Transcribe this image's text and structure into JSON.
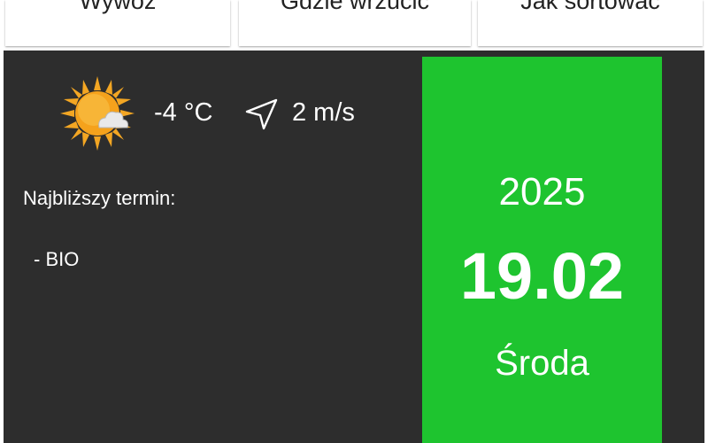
{
  "tabs": [
    {
      "label": "Wywóz"
    },
    {
      "label": "Gdzie wrzucić"
    },
    {
      "label": "Jak sortować"
    }
  ],
  "weather": {
    "temperature": "-4 °C",
    "wind": "2 m/s",
    "condition_icon": "sun-cloud-icon",
    "wind_icon": "navigation-arrow-icon"
  },
  "next_pickup": {
    "label": "Najbliższy termin:",
    "items": [
      "- BIO"
    ]
  },
  "date_card": {
    "year": "2025",
    "day_month": "19.02",
    "weekday": "Środa",
    "color": "#1ec42f"
  },
  "colors": {
    "panel_background": "#2d2d2d",
    "sun": "#f3a623"
  }
}
